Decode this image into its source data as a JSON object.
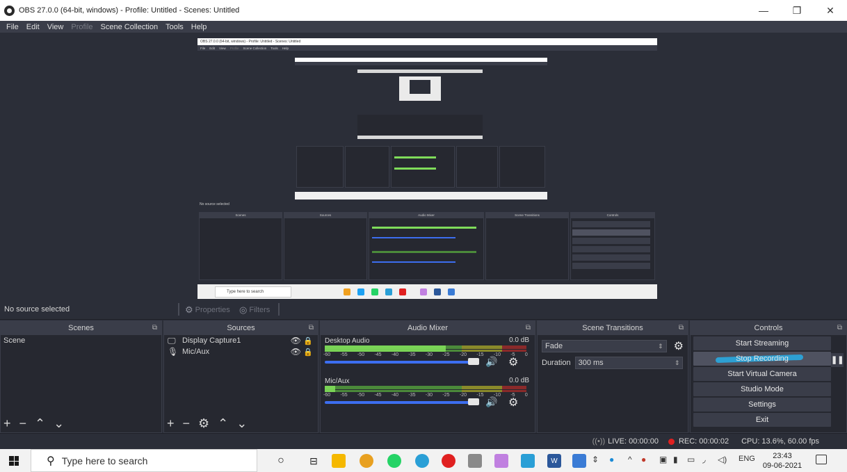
{
  "window": {
    "title": "OBS 27.0.0 (64-bit, windows) - Profile: Untitled - Scenes: Untitled",
    "min_glyph": "—",
    "max_glyph": "❐",
    "close_glyph": "✕"
  },
  "menu": [
    "File",
    "Edit",
    "View",
    "Profile",
    "Scene Collection",
    "Tools",
    "Help"
  ],
  "nested_preview": {
    "title": "OBS 27.0.0 (64-bit, windows) - Profile: Untitled - Scenes: Untitled",
    "menu": [
      "File",
      "Edit",
      "View",
      "Profile",
      "Scene Collection",
      "Tools",
      "Help"
    ],
    "no_source": "No source selected",
    "docks": [
      "Scenes",
      "Sources",
      "Audio Mixer",
      "Scene Transitions",
      "Controls"
    ],
    "search_placeholder": "Type here to search"
  },
  "context": {
    "no_source": "No source selected",
    "properties": "Properties",
    "filters": "Filters"
  },
  "scenes": {
    "header": "Scenes",
    "items": [
      "Scene"
    ]
  },
  "sources": {
    "header": "Sources",
    "items": [
      {
        "name": "Display Capture1",
        "icon": "monitor-icon"
      },
      {
        "name": "Mic/Aux",
        "icon": "microphone-icon"
      }
    ]
  },
  "mixer": {
    "header": "Audio Mixer",
    "channels": [
      {
        "name": "Desktop Audio",
        "db": "0.0 dB",
        "level": 0.6
      },
      {
        "name": "Mic/Aux",
        "db": "0.0 dB",
        "level": 0.05
      }
    ],
    "scale": [
      "-60",
      "-55",
      "-50",
      "-45",
      "-40",
      "-35",
      "-30",
      "-25",
      "-20",
      "-15",
      "-10",
      "-5",
      "0"
    ]
  },
  "transitions": {
    "header": "Scene Transitions",
    "selected": "Fade",
    "duration_label": "Duration",
    "duration_value": "300 ms"
  },
  "controls": {
    "header": "Controls",
    "buttons": [
      "Start Streaming",
      "Stop Recording",
      "Start Virtual Camera",
      "Studio Mode",
      "Settings",
      "Exit"
    ]
  },
  "status": {
    "live": "LIVE: 00:00:00",
    "rec": "REC: 00:00:02",
    "cpu": "CPU: 13.6%, 60.00 fps"
  },
  "taskbar": {
    "search_placeholder": "Type here to search",
    "lang": "ENG",
    "time": "23:43",
    "date": "09-06-2021"
  },
  "colors": {
    "accent": "#3c6ef0",
    "rec": "#e02020",
    "bg": "#2b2e38"
  }
}
